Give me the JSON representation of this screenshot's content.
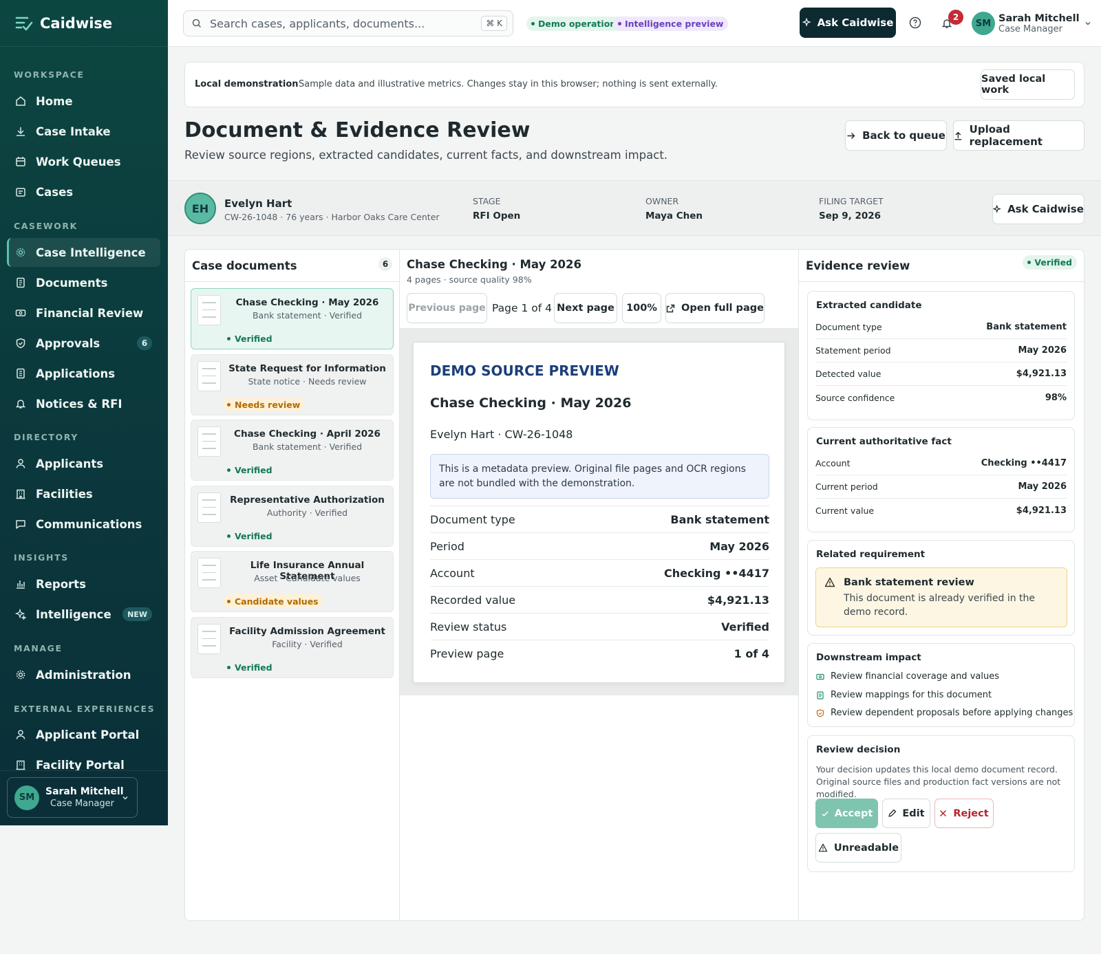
{
  "app": {
    "name": "Caidwise"
  },
  "sidebar": {
    "sections": {
      "workspace": "WORKSPACE",
      "casework": "CASEWORK",
      "directory": "DIRECTORY",
      "insights": "INSIGHTS",
      "manage": "MANAGE",
      "external": "EXTERNAL EXPERIENCES"
    },
    "items": {
      "home": "Home",
      "case_intake": "Case Intake",
      "work_queues": "Work Queues",
      "cases": "Cases",
      "case_intelligence": "Case Intelligence",
      "documents": "Documents",
      "financial_review": "Financial Review",
      "approvals": "Approvals",
      "approvals_count": "6",
      "applications": "Applications",
      "notices": "Notices & RFI",
      "applicants": "Applicants",
      "facilities": "Facilities",
      "communications": "Communications",
      "reports": "Reports",
      "intelligence": "Intelligence",
      "intelligence_badge": "NEW",
      "administration": "Administration",
      "applicant_portal": "Applicant Portal",
      "facility_portal": "Facility Portal"
    },
    "user": {
      "initials": "SM",
      "name": "Sarah Mitchell",
      "role": "Case Manager"
    }
  },
  "topbar": {
    "search_placeholder": "Search cases, applicants, documents...",
    "shortcut": "⌘ K",
    "pill_demo": "Demo operations",
    "pill_intel": "Intelligence preview",
    "ask": "Ask Caidwise",
    "notifications": "2",
    "user": {
      "initials": "SM",
      "name": "Sarah Mitchell",
      "role": "Case Manager"
    }
  },
  "banner": {
    "label": "Local demonstration",
    "text": "Sample data and illustrative metrics. Changes stay in this browser; nothing is sent externally.",
    "button": "Saved local work"
  },
  "page": {
    "title": "Document & Evidence Review",
    "subtitle": "Review source regions, extracted candidates, current facts, and downstream impact.",
    "back": "Back to queue",
    "upload": "Upload replacement"
  },
  "case": {
    "initials": "EH",
    "name": "Evelyn Hart",
    "meta": "CW-26-1048 · 76 years · Harbor Oaks Care Center",
    "stage_label": "STAGE",
    "stage": "RFI Open",
    "owner_label": "OWNER",
    "owner": "Maya Chen",
    "target_label": "FILING TARGET",
    "target": "Sep 9, 2026",
    "ask": "Ask Caidwise"
  },
  "documents": {
    "title": "Case documents",
    "count": "6",
    "items": [
      {
        "title": "Chase Checking · May 2026",
        "sub": "Bank statement · Verified",
        "status": "Verified"
      },
      {
        "title": "State Request for Information",
        "sub": "State notice · Needs review",
        "status": "Needs review"
      },
      {
        "title": "Chase Checking · April 2026",
        "sub": "Bank statement · Verified",
        "status": "Verified"
      },
      {
        "title": "Representative Authorization",
        "sub": "Authority · Verified",
        "status": "Verified"
      },
      {
        "title": "Life Insurance Annual Statement",
        "sub": "Asset · Candidate values",
        "status": "Candidate values"
      },
      {
        "title": "Facility Admission Agreement",
        "sub": "Facility · Verified",
        "status": "Verified"
      }
    ]
  },
  "viewer": {
    "title": "Chase Checking · May 2026",
    "meta": "4 pages · source quality 98%",
    "prev": "Previous page",
    "page": "Page 1 of 4",
    "next": "Next page",
    "zoom": "100%",
    "open": "Open full page",
    "preview_label": "DEMO SOURCE PREVIEW",
    "doc_title": "Chase Checking · May 2026",
    "person": "Evelyn Hart · CW-26-1048",
    "note": "This is a metadata preview. Original file pages and OCR regions are not bundled with the demonstration.",
    "rows": [
      {
        "k": "Document type",
        "v": "Bank statement"
      },
      {
        "k": "Period",
        "v": "May 2026"
      },
      {
        "k": "Account",
        "v": "Checking ••4417"
      },
      {
        "k": "Recorded value",
        "v": "$4,921.13"
      },
      {
        "k": "Review status",
        "v": "Verified"
      },
      {
        "k": "Preview page",
        "v": "1 of 4"
      }
    ]
  },
  "evidence": {
    "title": "Evidence review",
    "status": "Verified",
    "extracted": {
      "title": "Extracted candidate",
      "rows": [
        {
          "k": "Document type",
          "v": "Bank statement"
        },
        {
          "k": "Statement period",
          "v": "May 2026"
        },
        {
          "k": "Detected value",
          "v": "$4,921.13"
        },
        {
          "k": "Source confidence",
          "v": "98%"
        }
      ]
    },
    "current": {
      "title": "Current authoritative fact",
      "rows": [
        {
          "k": "Account",
          "v": "Checking ••4417"
        },
        {
          "k": "Current period",
          "v": "May 2026"
        },
        {
          "k": "Current value",
          "v": "$4,921.13"
        }
      ]
    },
    "requirement": {
      "title": "Related requirement",
      "alert_title": "Bank statement review",
      "alert_text": "This document is already verified in the demo record."
    },
    "impact": {
      "title": "Downstream impact",
      "items": [
        "Review financial coverage and values",
        "Review mappings for this document",
        "Review dependent proposals before applying changes"
      ]
    },
    "decision": {
      "title": "Review decision",
      "text": "Your decision updates this local demo document record. Original source files and production fact versions are not modified.",
      "accept": "Accept",
      "edit": "Edit",
      "reject": "Reject",
      "unreadable": "Unreadable"
    }
  }
}
